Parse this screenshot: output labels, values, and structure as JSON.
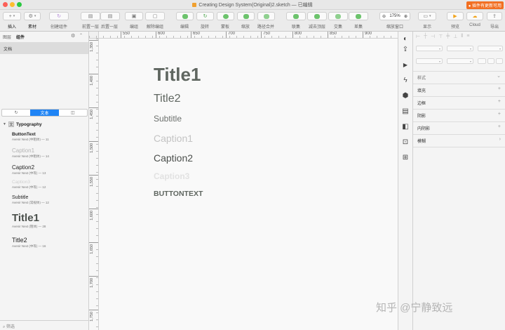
{
  "window": {
    "title": "Creating Design System(Original)2.sketch — 已编辑",
    "update_badge": "● 插件有更新可用"
  },
  "toolbar": {
    "insert": "插入",
    "assets": "素材",
    "create_symbol": "创建组件",
    "bring_forward": "前置一层",
    "send_backward": "后置一层",
    "group": "编组",
    "ungroup": "解除编组",
    "edit": "编辑",
    "rotate": "旋转",
    "mask": "蒙板",
    "scale": "缩放",
    "flatten": "路径合并",
    "union": "联集",
    "subtract": "减去顶层",
    "intersect": "交集",
    "difference": "差集",
    "zoom_window": "缩放窗口",
    "display": "显示",
    "preview": "预览",
    "cloud": "Cloud",
    "export": "导出",
    "zoom_value": "175%"
  },
  "left_panel": {
    "tab_layers": "图层",
    "tab_components": "组件",
    "library": "文档",
    "segments": [
      "",
      "文本",
      ""
    ],
    "group_icon": "文",
    "group_name": "Typography",
    "items": [
      {
        "name": "ButtonText",
        "meta": "Avenir Next (中粗体) — 11"
      },
      {
        "name": "Caption1",
        "meta": "Avenir Next (中粗体) — 14"
      },
      {
        "name": "Caption2",
        "meta": "Avenir Next (中等) — 13"
      },
      {
        "name": "Caption3",
        "meta": "Avenir Next (中等) — 12"
      },
      {
        "name": "Subtitle",
        "meta": "Avenir Next (常规体) — 12"
      },
      {
        "name": "Title1",
        "meta": "Avenir Next (粗体) — 28"
      },
      {
        "name": "Title2",
        "meta": "Avenir Next (中等) — 16"
      }
    ],
    "filter": "筛选"
  },
  "rulers": {
    "h_labels": [
      "550",
      "600",
      "650",
      "700",
      "750",
      "800",
      "850",
      "900"
    ],
    "v_labels": [
      "1,350",
      "1,400",
      "1,450",
      "1,500",
      "1,550",
      "1,600",
      "1,650",
      "1,700",
      "1,750"
    ]
  },
  "canvas": {
    "samples": [
      "Title1",
      "Title2",
      "Subtitle",
      "Caption1",
      "Caption2",
      "Caption3",
      "BUTTONTEXT"
    ]
  },
  "inspector": {
    "style": "样式",
    "fill": "填充",
    "border": "边框",
    "shadow": "阴影",
    "inner_shadow": "内阴影",
    "blur": "模糊"
  },
  "watermark": "知乎 @宁静致远",
  "colors": {
    "accent": "#1f84f5",
    "title_dark": "#5f6660",
    "muted_text": "#c4c4c4",
    "badge": "#f26f21"
  }
}
